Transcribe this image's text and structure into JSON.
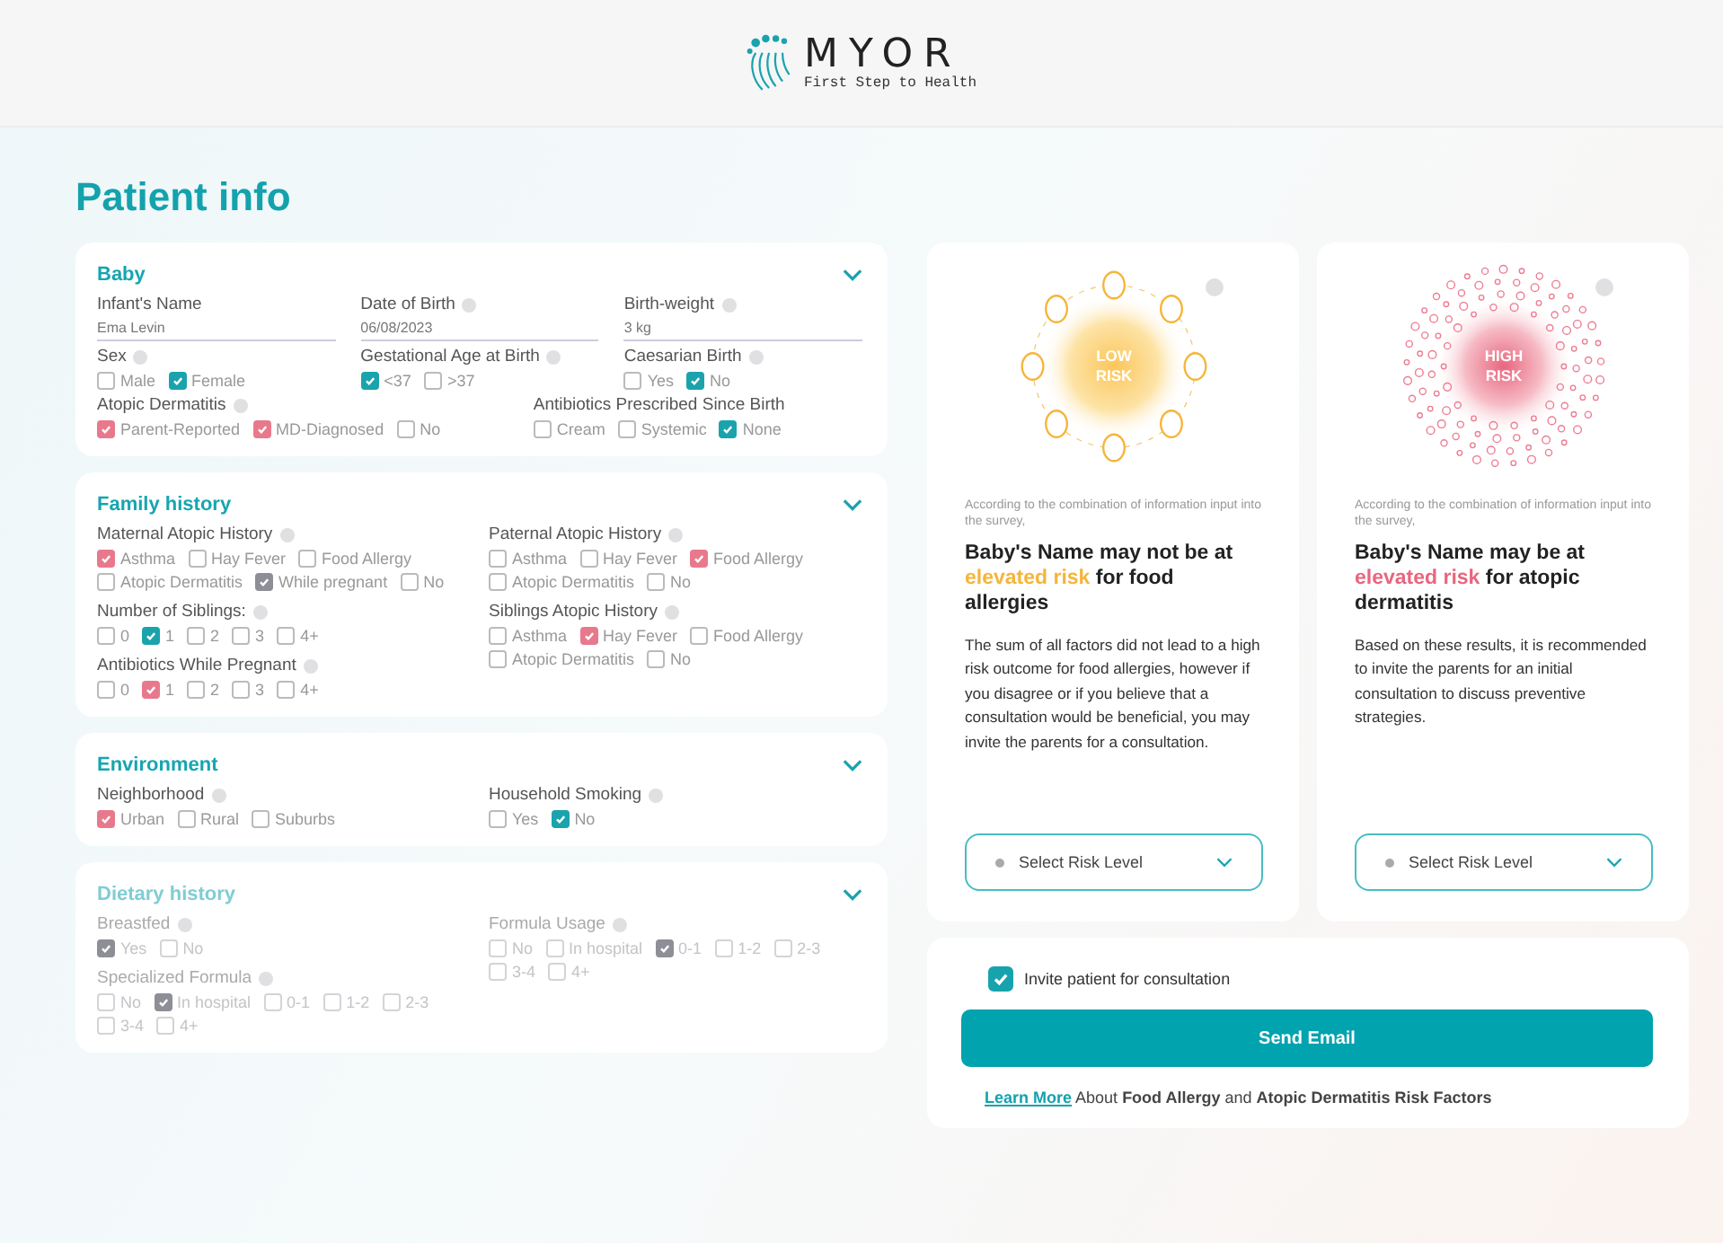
{
  "header": {
    "brand": "MYOR",
    "tagline": "First Step to Health"
  },
  "title": "Patient info",
  "sections": [
    {
      "title": "Baby",
      "disabled": false,
      "kind": "grid",
      "groups": [
        [
          {
            "kind": "text",
            "label": "Infant's Name",
            "info": false,
            "value": "Ema Levin"
          },
          {
            "kind": "text",
            "label": "Date of Birth",
            "info": true,
            "value": "06/08/2023"
          },
          {
            "kind": "text",
            "label": "Birth-weight",
            "info": true,
            "value": "3 kg"
          }
        ],
        [
          {
            "kind": "options",
            "label": "Sex",
            "info": true,
            "options": [
              {
                "label": "Male",
                "checked": false
              },
              {
                "label": "Female",
                "checked": true,
                "color": "#1aa3ad"
              }
            ]
          },
          {
            "kind": "options",
            "label": "Gestational Age at Birth",
            "info": true,
            "options": [
              {
                "label": "<37",
                "checked": true,
                "color": "#1aa3ad"
              },
              {
                "label": ">37",
                "checked": false
              }
            ]
          },
          {
            "kind": "options",
            "label": "Caesarian Birth",
            "info": true,
            "options": [
              {
                "label": "Yes",
                "checked": false
              },
              {
                "label": "No",
                "checked": true,
                "color": "#1aa3ad"
              }
            ]
          }
        ],
        [
          {
            "kind": "options",
            "label": "Atopic Dermatitis",
            "info": true,
            "options": [
              {
                "label": "Parent-Reported",
                "checked": true,
                "color": "#e8798c"
              },
              {
                "label": "MD-Diagnosed",
                "checked": true,
                "color": "#e8798c"
              },
              {
                "label": "No",
                "checked": false
              }
            ]
          },
          {
            "kind": "options",
            "label": "Antibiotics Prescribed Since Birth",
            "info": false,
            "options": [
              {
                "label": "Cream",
                "checked": false
              },
              {
                "label": "Systemic",
                "checked": false
              },
              {
                "label": "None",
                "checked": true,
                "color": "#1aa3ad"
              }
            ]
          }
        ]
      ]
    },
    {
      "title": "Family history",
      "disabled": false,
      "kind": "columns",
      "groups": [
        [
          {
            "kind": "options",
            "label": "Maternal Atopic History",
            "info": true,
            "options": [
              {
                "label": "Asthma",
                "checked": true,
                "color": "#e8798c"
              },
              {
                "label": "Hay Fever",
                "checked": false
              },
              {
                "label": "Food Allergy",
                "checked": false
              },
              {
                "label": "Atopic Dermatitis",
                "checked": false
              },
              {
                "label": "While pregnant",
                "checked": true,
                "color": "#8e8e96"
              },
              {
                "label": "No",
                "checked": false
              }
            ]
          },
          {
            "kind": "options",
            "label": "Number of Siblings:",
            "info": true,
            "options": [
              {
                "label": "0",
                "checked": false
              },
              {
                "label": "1",
                "checked": true,
                "color": "#1aa3ad"
              },
              {
                "label": "2",
                "checked": false
              },
              {
                "label": "3",
                "checked": false
              },
              {
                "label": "4+",
                "checked": false
              }
            ]
          },
          {
            "kind": "options",
            "label": "Antibiotics While Pregnant",
            "info": true,
            "options": [
              {
                "label": "0",
                "checked": false
              },
              {
                "label": "1",
                "checked": true,
                "color": "#e8798c"
              },
              {
                "label": "2",
                "checked": false
              },
              {
                "label": "3",
                "checked": false
              },
              {
                "label": "4+",
                "checked": false
              }
            ]
          }
        ],
        [
          {
            "kind": "options",
            "label": "Paternal Atopic History",
            "info": true,
            "options": [
              {
                "label": "Asthma",
                "checked": false
              },
              {
                "label": "Hay Fever",
                "checked": false
              },
              {
                "label": "Food Allergy",
                "checked": true,
                "color": "#e8798c"
              },
              {
                "label": "Atopic Dermatitis",
                "checked": false
              },
              {
                "label": "No",
                "checked": false
              }
            ]
          },
          {
            "kind": "options",
            "label": "Siblings Atopic History",
            "info": true,
            "options": [
              {
                "label": "Asthma",
                "checked": false
              },
              {
                "label": "Hay Fever",
                "checked": true,
                "color": "#e8798c"
              },
              {
                "label": "Food Allergy",
                "checked": false
              },
              {
                "label": "Atopic Dermatitis",
                "checked": false
              },
              {
                "label": "No",
                "checked": false
              }
            ]
          }
        ]
      ]
    },
    {
      "title": "Environment",
      "disabled": false,
      "kind": "columns",
      "groups": [
        [
          {
            "kind": "options",
            "label": "Neighborhood",
            "info": true,
            "options": [
              {
                "label": "Urban",
                "checked": true,
                "color": "#e8798c"
              },
              {
                "label": "Rural",
                "checked": false
              },
              {
                "label": "Suburbs",
                "checked": false
              }
            ]
          }
        ],
        [
          {
            "kind": "options",
            "label": "Household Smoking",
            "info": true,
            "options": [
              {
                "label": "Yes",
                "checked": false
              },
              {
                "label": "No",
                "checked": true,
                "color": "#1aa3ad"
              }
            ]
          }
        ]
      ]
    },
    {
      "title": "Dietary history",
      "disabled": true,
      "kind": "columns",
      "groups": [
        [
          {
            "kind": "options",
            "label": "Breastfed",
            "info": true,
            "options": [
              {
                "label": "Yes",
                "checked": true,
                "color": "#8e8e96"
              },
              {
                "label": "No",
                "checked": false
              }
            ]
          },
          {
            "kind": "options",
            "label": "Specialized Formula",
            "info": true,
            "options": [
              {
                "label": "No",
                "checked": false
              },
              {
                "label": "In hospital",
                "checked": true,
                "color": "#8e8e96"
              },
              {
                "label": "0-1",
                "checked": false
              },
              {
                "label": "1-2",
                "checked": false
              },
              {
                "label": "2-3",
                "checked": false
              },
              {
                "label": "3-4",
                "checked": false
              },
              {
                "label": "4+",
                "checked": false
              }
            ]
          }
        ],
        [
          {
            "kind": "options",
            "label": "Formula Usage",
            "info": true,
            "options": [
              {
                "label": "No",
                "checked": false
              },
              {
                "label": "In hospital",
                "checked": false
              },
              {
                "label": "0-1",
                "checked": true,
                "color": "#8e8e96"
              },
              {
                "label": "1-2",
                "checked": false
              },
              {
                "label": "2-3",
                "checked": false
              },
              {
                "label": "3-4",
                "checked": false
              },
              {
                "label": "4+",
                "checked": false
              }
            ]
          }
        ]
      ]
    }
  ],
  "risk_cards": [
    {
      "kind": "low",
      "badge": "LOW RISK",
      "note": "According to the combination of information input into the survey,",
      "headline_start": "Baby's Name may not be at",
      "highlight": "elevated  risk",
      "headline_end": "for food allergies",
      "body": "The sum of all factors did not lead to a high risk outcome for food allergies, however if you disagree or if you believe that a consultation would be beneficial, you may  invite the parents for a consultation.",
      "select_placeholder": "Select Risk Level"
    },
    {
      "kind": "high",
      "badge": "HIGH RISK",
      "note": "According to the combination of information input into the survey,",
      "headline_start": "Baby's Name may be at",
      "highlight": "elevated  risk",
      "headline_end": "for atopic dermatitis",
      "body": "Based on these results, it is recommended to invite the parents for an initial consultation to discuss preventive strategies.",
      "select_placeholder": "Select Risk Level"
    }
  ],
  "consultation": {
    "invite": {
      "label": "Invite patient for consultation",
      "checked": true
    },
    "button": "Send Email",
    "link": "Learn More",
    "link_text": "About **Food Allergy** and **Atopic Dermatitis Risk Factors**"
  }
}
